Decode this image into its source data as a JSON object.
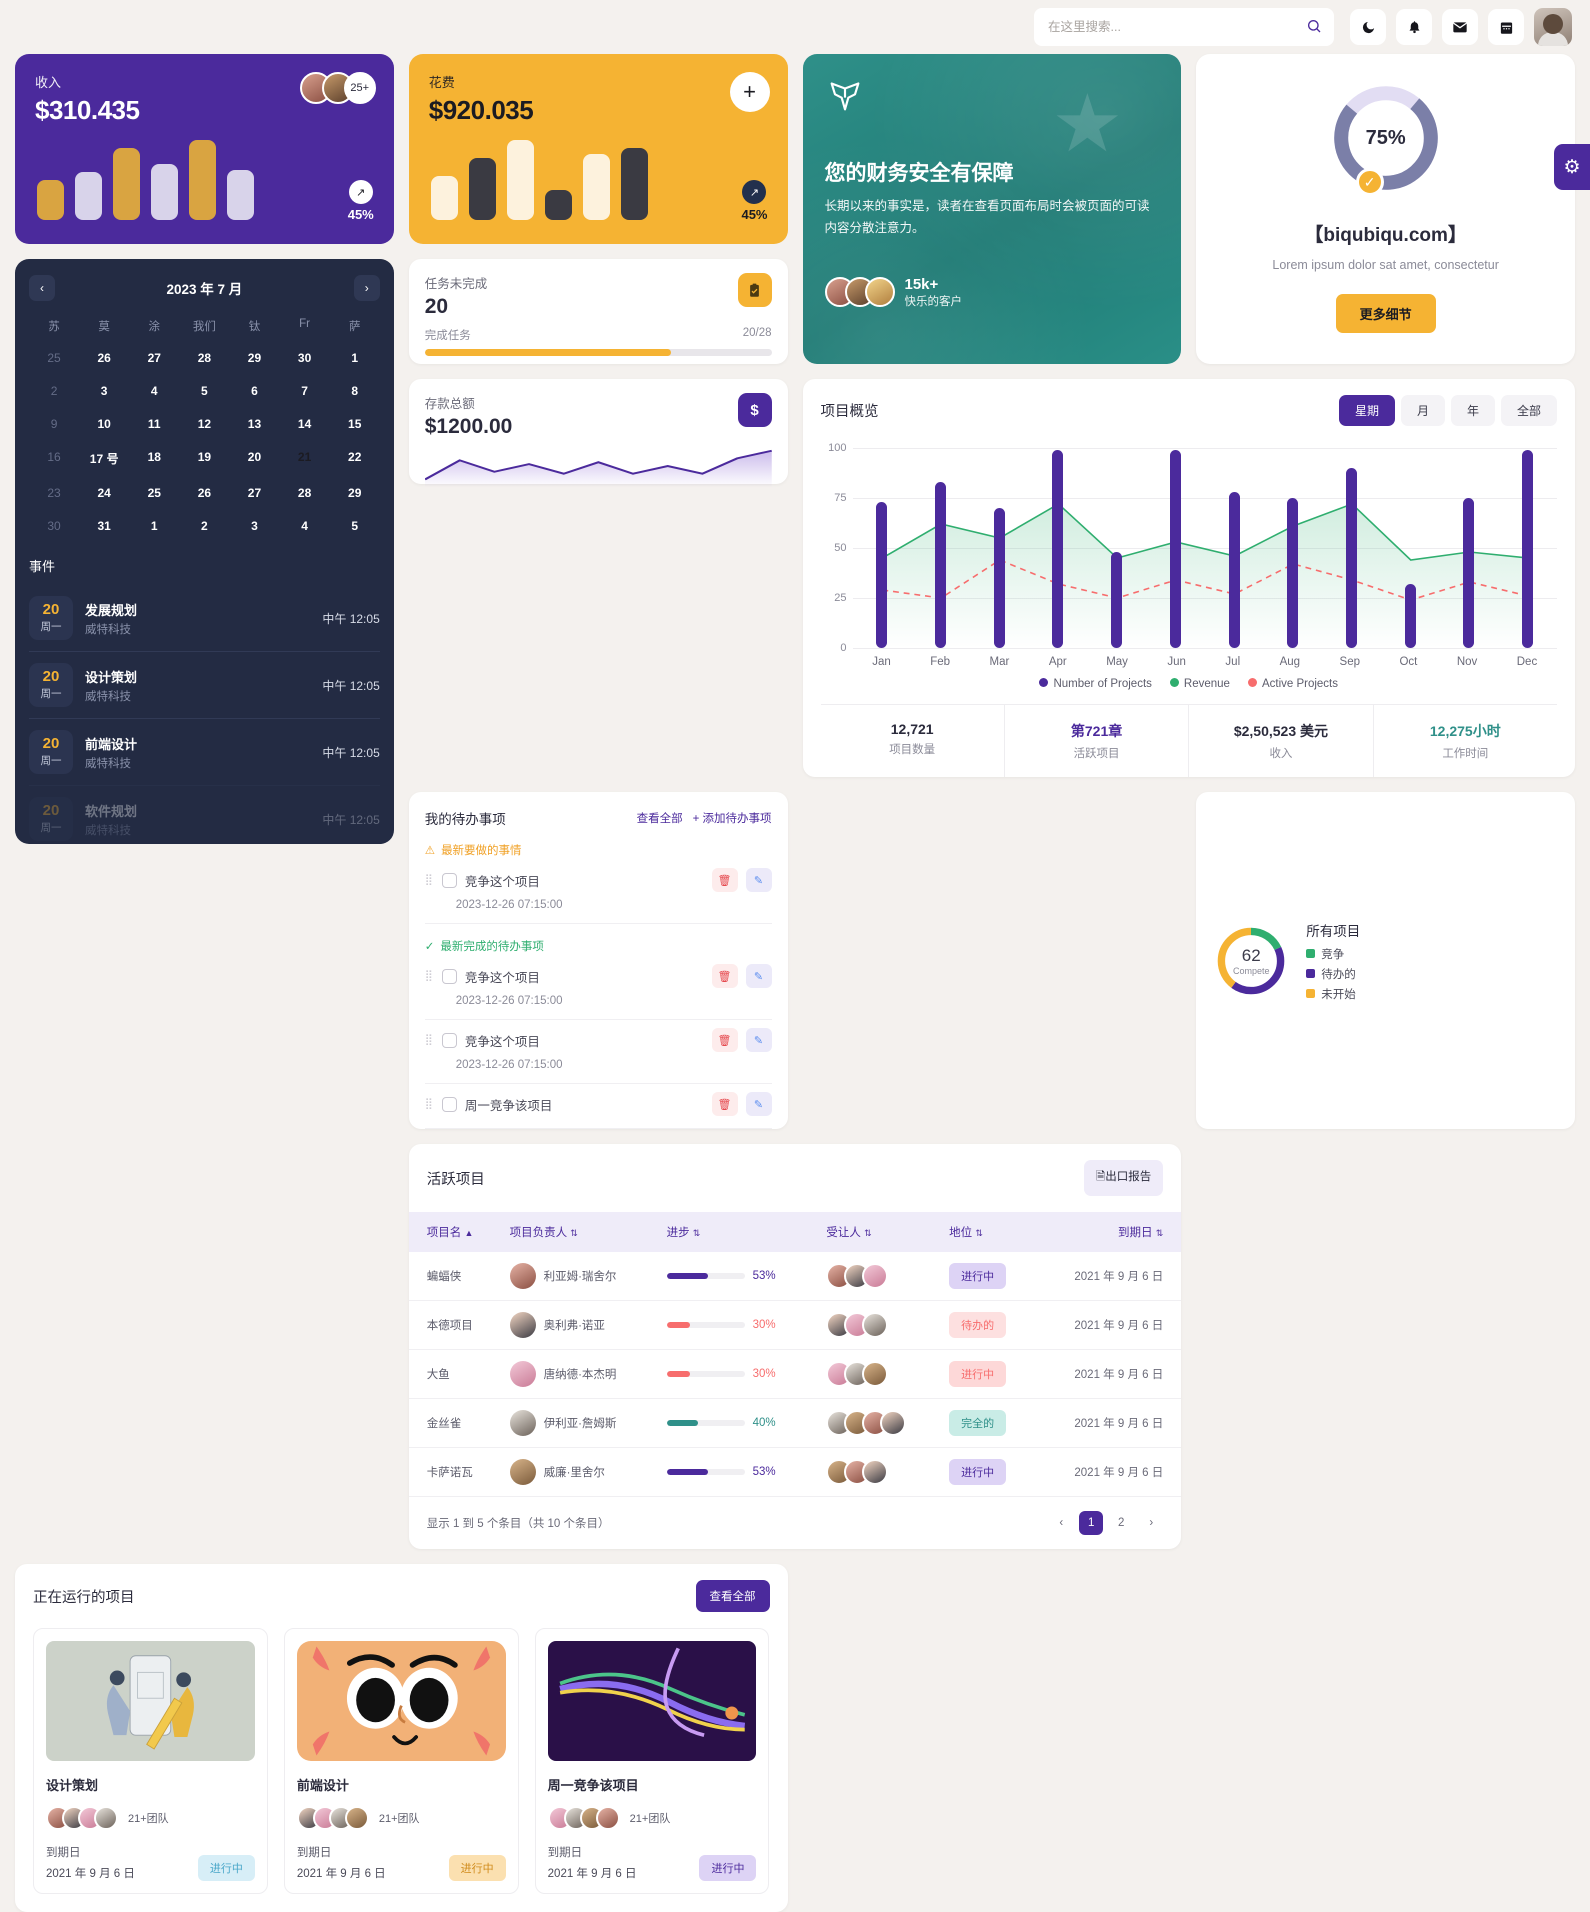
{
  "header": {
    "search_placeholder": "在这里搜索...",
    "icons": [
      {
        "name": "moon-icon",
        "glyph": "☽"
      },
      {
        "name": "bell-icon",
        "glyph": "🔔"
      },
      {
        "name": "mail-icon",
        "glyph": "✉"
      },
      {
        "name": "calendar-icon",
        "glyph": "📅"
      }
    ]
  },
  "revenue": {
    "label": "收入",
    "value": "$310.435",
    "trend": "45%",
    "avatar_more": "25+",
    "bars": [
      40,
      48,
      72,
      56,
      80,
      50
    ]
  },
  "expense": {
    "label": "花费",
    "value": "$920.035",
    "trend": "45%",
    "add_label": "+",
    "bars": [
      44,
      62,
      80,
      30,
      66,
      72
    ]
  },
  "tasks": {
    "title": "任务未完成",
    "number": "20",
    "sub_left": "完成任务",
    "sub_right": "20/28",
    "progress": 71,
    "icon": "clipboard-icon"
  },
  "deposit": {
    "title": "存款总额",
    "value": "$1200.00",
    "icon": "dollar-icon"
  },
  "promo": {
    "heading": "您的财务安全有保障",
    "paragraph": "长期以来的事实是，读者在查看页面布局时会被页面的可读内容分散注意力。",
    "count": "15k+",
    "count_label": "快乐的客户"
  },
  "progress_card": {
    "percent": "75%",
    "percent_value": 75,
    "title": "【biqubiqu.com】",
    "subtitle": "Lorem ipsum dolor sat amet, consectetur",
    "button": "更多细节"
  },
  "calendar": {
    "month_title": "2023 年 7 月",
    "prev": "‹",
    "next": "›",
    "dows": [
      "苏",
      "莫",
      "涂",
      "我们",
      "钛",
      "Fr",
      "萨"
    ],
    "weeks": [
      [
        {
          "d": "25",
          "mut": true
        },
        {
          "d": "26"
        },
        {
          "d": "27"
        },
        {
          "d": "28"
        },
        {
          "d": "29"
        },
        {
          "d": "30"
        },
        {
          "d": "1"
        }
      ],
      [
        {
          "d": "2",
          "mut": true
        },
        {
          "d": "3"
        },
        {
          "d": "4"
        },
        {
          "d": "5"
        },
        {
          "d": "6"
        },
        {
          "d": "7"
        },
        {
          "d": "8"
        }
      ],
      [
        {
          "d": "9",
          "mut": true
        },
        {
          "d": "10"
        },
        {
          "d": "11"
        },
        {
          "d": "12"
        },
        {
          "d": "13"
        },
        {
          "d": "14"
        },
        {
          "d": "15"
        }
      ],
      [
        {
          "d": "16",
          "mut": true
        },
        {
          "d": "17 号"
        },
        {
          "d": "18"
        },
        {
          "d": "19"
        },
        {
          "d": "20"
        },
        {
          "d": "21",
          "sel": true
        },
        {
          "d": "22"
        }
      ],
      [
        {
          "d": "23",
          "mut": true
        },
        {
          "d": "24"
        },
        {
          "d": "25"
        },
        {
          "d": "26"
        },
        {
          "d": "27"
        },
        {
          "d": "28"
        },
        {
          "d": "29"
        }
      ],
      [
        {
          "d": "30",
          "mut": true
        },
        {
          "d": "31"
        },
        {
          "d": "1"
        },
        {
          "d": "2"
        },
        {
          "d": "3"
        },
        {
          "d": "4"
        },
        {
          "d": "5"
        }
      ]
    ],
    "events_title": "事件",
    "events": [
      {
        "day": "20",
        "weekday": "周一",
        "name": "发展规划",
        "company": "威特科技",
        "time": "中午 12:05"
      },
      {
        "day": "20",
        "weekday": "周一",
        "name": "设计策划",
        "company": "威特科技",
        "time": "中午 12:05"
      },
      {
        "day": "20",
        "weekday": "周一",
        "name": "前端设计",
        "company": "威特科技",
        "time": "中午 12:05"
      },
      {
        "day": "20",
        "weekday": "周一",
        "name": "软件规划",
        "company": "威特科技",
        "time": "中午 12:05"
      }
    ]
  },
  "chart_data": {
    "type": "bar",
    "title": "项目概览",
    "categories": [
      "Jan",
      "Feb",
      "Mar",
      "Apr",
      "May",
      "Jun",
      "Jul",
      "Aug",
      "Sep",
      "Oct",
      "Nov",
      "Dec"
    ],
    "series": [
      {
        "name": "Number of Projects",
        "type": "bar",
        "color": "#4b2a9c",
        "values": [
          73,
          83,
          70,
          99,
          48,
          99,
          78,
          75,
          90,
          32,
          75,
          99
        ]
      },
      {
        "name": "Revenue",
        "type": "area",
        "color": "#2fae6f",
        "values": [
          45,
          62,
          55,
          72,
          45,
          53,
          46,
          61,
          72,
          44,
          48,
          45
        ]
      },
      {
        "name": "Active Projects",
        "type": "line-dashed",
        "color": "#f76d6d",
        "values": [
          29,
          25,
          44,
          32,
          25,
          34,
          27,
          42,
          34,
          24,
          33,
          26
        ]
      }
    ],
    "ylim": [
      0,
      100
    ],
    "yticks": [
      0,
      25,
      50,
      75,
      100
    ],
    "xlabel": "",
    "ylabel": "",
    "grid": true,
    "legend_position": "bottom"
  },
  "chart_card": {
    "title": "项目概览",
    "segments": [
      {
        "label": "星期",
        "active": true
      },
      {
        "label": "月",
        "active": false
      },
      {
        "label": "年",
        "active": false
      },
      {
        "label": "全部",
        "active": false
      }
    ],
    "legend": [
      {
        "label": "Number of Projects",
        "color": "#4b2a9c"
      },
      {
        "label": "Revenue",
        "color": "#2fae6f"
      },
      {
        "label": "Active Projects",
        "color": "#f76d6d"
      }
    ],
    "stats": [
      {
        "value": "12,721",
        "label": "项目数量",
        "color": "#2b2b3c"
      },
      {
        "value": "第721章",
        "label": "活跃项目",
        "color": "#4b2a9c"
      },
      {
        "value": "$2,50,523 美元",
        "label": "收入",
        "color": "#2b2b3c"
      },
      {
        "value": "12,275小时",
        "label": "工作时间",
        "color": "#2f9089"
      }
    ]
  },
  "todo": {
    "title": "我的待办事项",
    "view_all": "查看全部",
    "add": "+ 添加待办事项",
    "section_pending": "最新要做的事情",
    "section_done": "最新完成的待办事项",
    "items": [
      {
        "text": "竞争这个项目",
        "date": "2023-12-26 07:15:00",
        "section": "pending"
      },
      {
        "text": "竞争这个项目",
        "date": "2023-12-26 07:15:00",
        "section": "done"
      },
      {
        "text": "竞争这个项目",
        "date": "2023-12-26 07:15:00",
        "section": ""
      },
      {
        "text": "周一竞争该项目",
        "date": "",
        "section": ""
      }
    ]
  },
  "all_projects": {
    "title": "所有项目",
    "center_number": "62",
    "center_label": "Compete",
    "legend": [
      {
        "label": "竞争",
        "color": "#2fae6f",
        "value": 18
      },
      {
        "label": "待办的",
        "color": "#4b2a9c",
        "value": 42
      },
      {
        "label": "未开始",
        "color": "#f5b333",
        "value": 40
      }
    ]
  },
  "table": {
    "title": "活跃项目",
    "export_label": "出口报告",
    "columns": [
      "项目名",
      "项目负责人",
      "进步",
      "受让人",
      "地位",
      "到期日"
    ],
    "rows": [
      {
        "project": "蝙蝠侠",
        "owner": "利亚姆·瑞舍尔",
        "progress": 53,
        "progress_text": "53%",
        "progress_color": "#4b2a9c",
        "assignees": 3,
        "status": "进行中",
        "status_bg": "#ddd3f5",
        "status_fg": "#4b2a9c",
        "due": "2021 年 9 月 6 日"
      },
      {
        "project": "本德项目",
        "owner": "奥利弗·诺亚",
        "progress": 30,
        "progress_text": "30%",
        "progress_color": "#f76d6d",
        "assignees": 3,
        "status": "待办的",
        "status_bg": "#fde0e0",
        "status_fg": "#f76d6d",
        "due": "2021 年 9 月 6 日"
      },
      {
        "project": "大鱼",
        "owner": "唐纳德·本杰明",
        "progress": 30,
        "progress_text": "30%",
        "progress_color": "#f76d6d",
        "assignees": 3,
        "status": "进行中",
        "status_bg": "#fdd8d8",
        "status_fg": "#f76d6d",
        "due": "2021 年 9 月 6 日"
      },
      {
        "project": "金丝雀",
        "owner": "伊利亚·詹姆斯",
        "progress": 40,
        "progress_text": "40%",
        "progress_color": "#2f9089",
        "assignees": 4,
        "status": "完全的",
        "status_bg": "#c9ece6",
        "status_fg": "#2f9089",
        "due": "2021 年 9 月 6 日"
      },
      {
        "project": "卡萨诺瓦",
        "owner": "威廉·里舍尔",
        "progress": 53,
        "progress_text": "53%",
        "progress_color": "#4b2a9c",
        "assignees": 3,
        "status": "进行中",
        "status_bg": "#ddd3f5",
        "status_fg": "#4b2a9c",
        "due": "2021 年 9 月 6 日"
      }
    ],
    "footer": "显示 1 到 5 个条目（共 10 个条目）",
    "pages": [
      "1",
      "2"
    ]
  },
  "running": {
    "title": "正在运行的项目",
    "view_all": "查看全部",
    "cards": [
      {
        "name": "设计策划",
        "team": "21+团队",
        "due_label": "到期日",
        "due": "2021 年 9 月 6 日",
        "status": "进行中",
        "status_bg": "#d7eef7",
        "status_fg": "#4aa7c9",
        "thumb": "design-planning-illustration"
      },
      {
        "name": "前端设计",
        "team": "21+团队",
        "due_label": "到期日",
        "due": "2021 年 9 月 6 日",
        "status": "进行中",
        "status_bg": "#fbe0b0",
        "status_fg": "#d08b1c",
        "thumb": "cartoon-face-illustration"
      },
      {
        "name": "周一竞争该项目",
        "team": "21+团队",
        "due_label": "到期日",
        "due": "2021 年 9 月 6 日",
        "status": "进行中",
        "status_bg": "#ddd3f5",
        "status_fg": "#4b2a9c",
        "thumb": "abstract-lines-illustration"
      }
    ]
  },
  "settings_tab": {
    "icon": "gear-icon",
    "glyph": "⚙"
  }
}
